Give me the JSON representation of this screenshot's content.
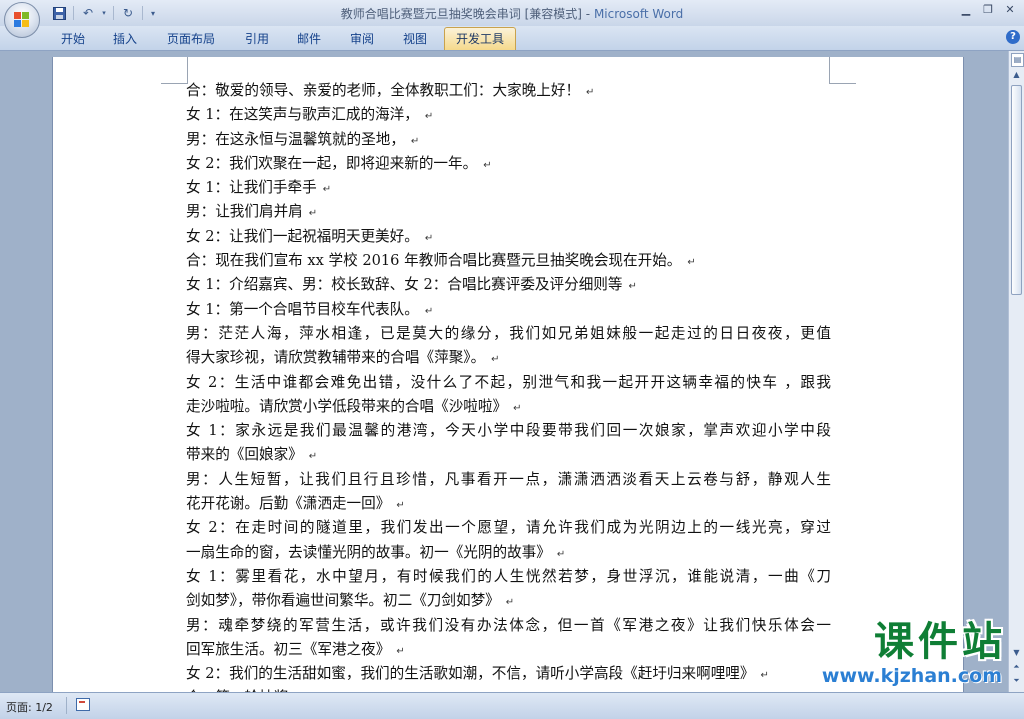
{
  "window": {
    "title": "教师合唱比赛暨元旦抽奖晚会串词 [兼容模式]",
    "title_separator": " - ",
    "app_name": "Microsoft Word"
  },
  "ribbon": {
    "tabs": [
      {
        "label": "开始"
      },
      {
        "label": "插入"
      },
      {
        "label": "页面布局"
      },
      {
        "label": "引用"
      },
      {
        "label": "邮件"
      },
      {
        "label": "审阅"
      },
      {
        "label": "视图"
      },
      {
        "label": "开发工具",
        "active": true
      }
    ]
  },
  "document": {
    "lines": [
      "合：敬爱的领导、亲爱的老师，全体教职工们：大家晚上好！",
      "女 1：在这笑声与歌声汇成的海洋，",
      "男：在这永恒与温馨筑就的圣地，",
      "女 2：我们欢聚在一起，即将迎来新的一年。",
      "女 1：让我们手牵手",
      "男：让我们肩并肩",
      "女 2：让我们一起祝福明天更美好。",
      "合：现在我们宣布 xx 学校 2016 年教师合唱比赛暨元旦抽奖晚会现在开始。",
      "女 1：介绍嘉宾、男：校长致辞、女 2：合唱比赛评委及评分细则等",
      "女 1：第一个合唱节目校车代表队。",
      "男：茫茫人海，萍水相逢，已是莫大的缘分，我们如兄弟姐妹般一起走过的日日夜夜，更值",
      "得大家珍视，请欣赏教辅带来的合唱《萍聚》。",
      "女 2：生活中谁都会难免出错，没什么了不起，别泄气和我一起开开这辆幸福的快车 ，跟我",
      "走沙啦啦。请欣赏小学低段带来的合唱《沙啦啦》",
      "女 1：家永远是我们最温馨的港湾，今天小学中段要带我们回一次娘家，掌声欢迎小学中段",
      "带来的《回娘家》",
      "男：人生短暂，让我们且行且珍惜，凡事看开一点，潇潇洒洒淡看天上云卷与舒，静观人生",
      "花开花谢。后勤《潇洒走一回》",
      "女 2：在走时间的隧道里，我们发出一个愿望，请允许我们成为光阴边上的一线光亮，穿过",
      "一扇生命的窗，去读懂光阴的故事。初一《光阴的故事》",
      "女 1：雾里看花，水中望月，有时候我们的人生恍然若梦，身世浮沉，谁能说清，一曲《刀",
      "剑如梦》，带你看遍世间繁华。初二《刀剑如梦》",
      "男：魂牵梦绕的军营生活，或许我们没有办法体念，但一首《军港之夜》让我们快乐体会一",
      "回军旅生活。初三《军港之夜》",
      "女 2：我们的生活甜如蜜，我们的生活歌如潮，不信，请听小学高段《赶圩归来啊哩哩》",
      "合：第一轮抽奖"
    ],
    "paragraph_mark": "↵"
  },
  "statusbar": {
    "page_indicator": "页面: 1/2"
  },
  "watermark": {
    "main": "课件站",
    "url": "www.kjzhan.com"
  },
  "colors": {
    "tab_text": "#15428b",
    "app_name": "#4a6fa8",
    "watermark_main": "#0f7e35",
    "watermark_url": "#2b7fd3"
  }
}
